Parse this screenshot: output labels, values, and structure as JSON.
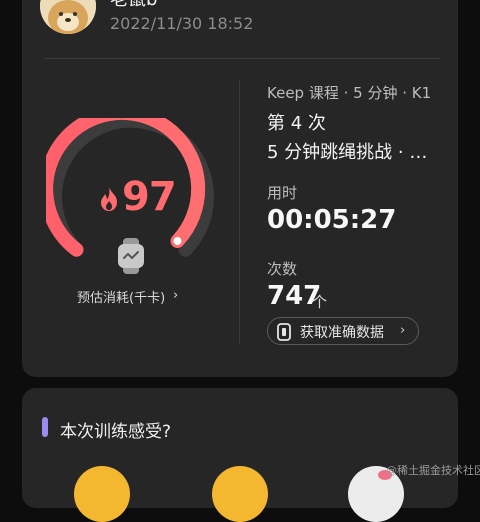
{
  "user": {
    "name": "老鼠b",
    "timestamp": "2022/11/30 18:52"
  },
  "calories": {
    "value": "97",
    "label": "预估消耗(千卡)",
    "gauge_fraction": 0.83,
    "color": "#ff6b6e"
  },
  "course": {
    "meta": "Keep 课程 · 5 分钟 · K1",
    "session": "第 4 次",
    "name": "5 分钟跳绳挑战 · …"
  },
  "stats": {
    "duration_label": "用时",
    "duration_value": "00:05:27",
    "count_label": "次数",
    "count_value": "747",
    "count_unit": "个"
  },
  "accurate_button": {
    "label": "获取准确数据"
  },
  "feeling": {
    "title": "本次训练感受?",
    "accent": "#9a8cf0"
  },
  "icons": [
    "flame-icon",
    "watch-icon",
    "chevron-right-icon",
    "phone-icon"
  ],
  "watermark": "@稀土掘金技术社区"
}
